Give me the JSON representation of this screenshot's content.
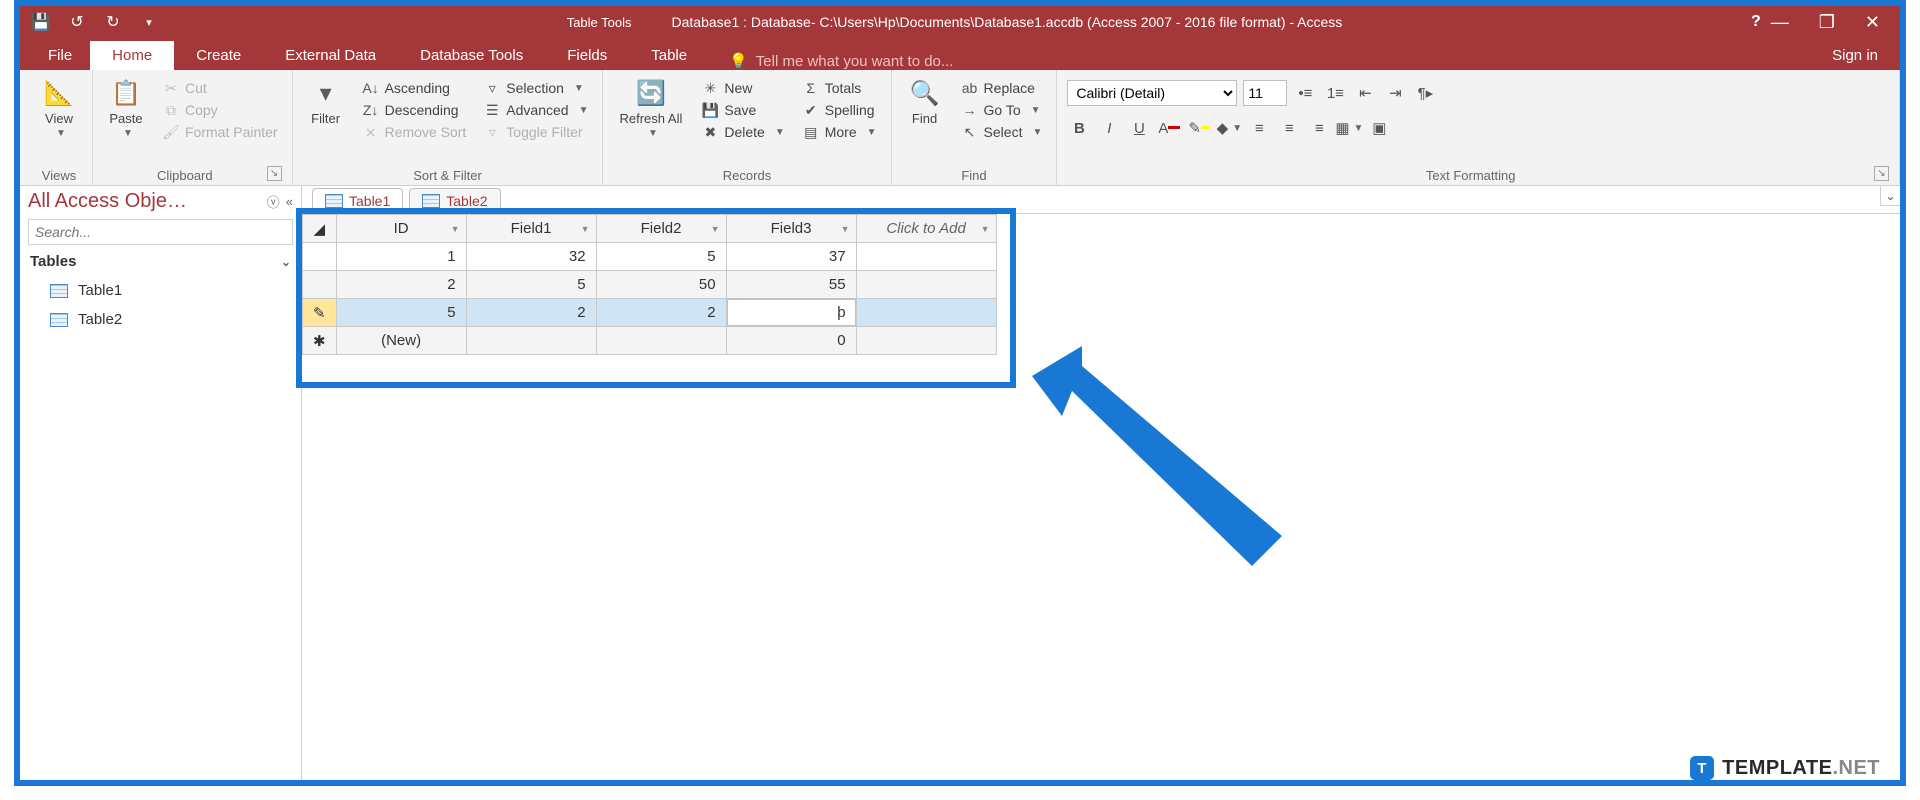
{
  "titlebar": {
    "context_tool": "Table Tools",
    "title": "Database1 : Database- C:\\Users\\Hp\\Documents\\Database1.accdb (Access 2007 - 2016 file format) - Access"
  },
  "wincontrols": {
    "help": "?",
    "min": "—",
    "restore": "❐",
    "close": "✕"
  },
  "tabs": {
    "file": "File",
    "home": "Home",
    "create": "Create",
    "external": "External Data",
    "dbtools": "Database Tools",
    "fields": "Fields",
    "table": "Table",
    "tellme_placeholder": "Tell me what you want to do...",
    "signin": "Sign in"
  },
  "ribbon": {
    "views": {
      "view": "View",
      "label": "Views"
    },
    "clipboard": {
      "paste": "Paste",
      "cut": "Cut",
      "copy": "Copy",
      "painter": "Format Painter",
      "label": "Clipboard"
    },
    "sortfilter": {
      "filter": "Filter",
      "asc": "Ascending",
      "desc": "Descending",
      "remove": "Remove Sort",
      "selection": "Selection",
      "advanced": "Advanced",
      "toggle": "Toggle Filter",
      "label": "Sort & Filter"
    },
    "records": {
      "refresh": "Refresh All",
      "new": "New",
      "save": "Save",
      "delete": "Delete",
      "totals": "Totals",
      "spelling": "Spelling",
      "more": "More",
      "label": "Records"
    },
    "find": {
      "find": "Find",
      "replace": "Replace",
      "goto": "Go To",
      "select": "Select",
      "label": "Find"
    },
    "textfmt": {
      "font": "Calibri (Detail)",
      "size": "11",
      "label": "Text Formatting"
    }
  },
  "nav": {
    "title": "All Access Obje…",
    "search_placeholder": "Search...",
    "group": "Tables",
    "items": [
      "Table1",
      "Table2"
    ]
  },
  "doctabs": [
    "Table1",
    "Table2"
  ],
  "grid": {
    "headers": {
      "id": "ID",
      "f1": "Field1",
      "f2": "Field2",
      "f3": "Field3",
      "add": "Click to Add"
    },
    "rows": [
      {
        "id": "1",
        "f1": "32",
        "f2": "5",
        "f3": "37"
      },
      {
        "id": "2",
        "f1": "5",
        "f2": "50",
        "f3": "55"
      },
      {
        "id": "5",
        "f1": "2",
        "f2": "2",
        "f3": "þ",
        "editing": true,
        "selected": true
      },
      {
        "id": "(New)",
        "f1": "",
        "f2": "",
        "f3": "0",
        "newrow": true
      }
    ]
  },
  "watermark": {
    "brand1": "TEMPLATE",
    "brand2": ".NET",
    "ic": "T"
  }
}
